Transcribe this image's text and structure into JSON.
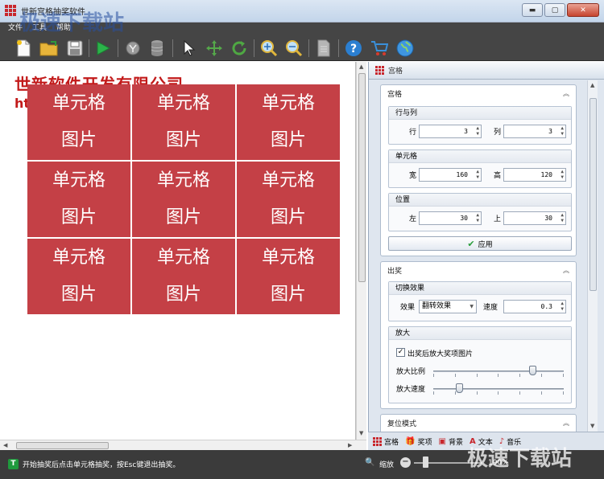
{
  "window": {
    "title": "世新宫格抽奖软件",
    "minimize": "▬",
    "maximize": "▢",
    "close": "✕"
  },
  "menu": {
    "items": [
      "文件",
      "工具",
      "帮助"
    ]
  },
  "toolbar": {
    "buttons": [
      "new-icon",
      "open-icon",
      "save-icon",
      "play-icon",
      "filter-icon",
      "database-icon",
      "pointer-icon",
      "move-icon",
      "refresh-icon",
      "zoom-in-icon",
      "zoom-out-icon",
      "document-icon",
      "help-icon",
      "cart-icon",
      "globe-icon"
    ]
  },
  "canvas": {
    "company": "世新软件开发有限公司",
    "url": "ht",
    "cell_line1": "单元格",
    "cell_line2": "图片"
  },
  "panel": {
    "header": "宫格",
    "grid_section": {
      "title": "宫格",
      "rows_cols": {
        "title": "行与列",
        "row_label": "行",
        "row_value": "3",
        "col_label": "列",
        "col_value": "3"
      },
      "cell": {
        "title": "单元格",
        "width_label": "宽",
        "width_value": "160",
        "height_label": "高",
        "height_value": "120"
      },
      "position": {
        "title": "位置",
        "left_label": "左",
        "left_value": "30",
        "top_label": "上",
        "top_value": "30"
      },
      "apply_label": "应用"
    },
    "prize_section": {
      "title": "出奖",
      "switch_effect": {
        "title": "切换效果",
        "effect_label": "效果",
        "effect_value": "翻转效果",
        "speed_label": "速度",
        "speed_value": "0.3"
      },
      "zoom": {
        "title": "放大",
        "checkbox_label": "出奖后放大奖项图片",
        "checked": true,
        "ratio_label": "放大比例",
        "ratio_level": 0.76,
        "speed_label": "放大速度",
        "speed_level": 0.2
      }
    },
    "reset_section": {
      "title": "复位模式"
    },
    "tabs": [
      "宫格",
      "奖项",
      "背景",
      "文本",
      "音乐"
    ]
  },
  "status": {
    "text": "开始抽奖后点击单元格抽奖，按Esc键退出抽奖。",
    "zoom_label": "缩放",
    "zoom_value": "100%"
  },
  "watermark": {
    "top": "极速下载站",
    "bottom": "极速下载站"
  },
  "colors": {
    "accent_red": "#c44046",
    "toolbar_bg": "#454545",
    "panel_bg": "#dfe6ef"
  }
}
